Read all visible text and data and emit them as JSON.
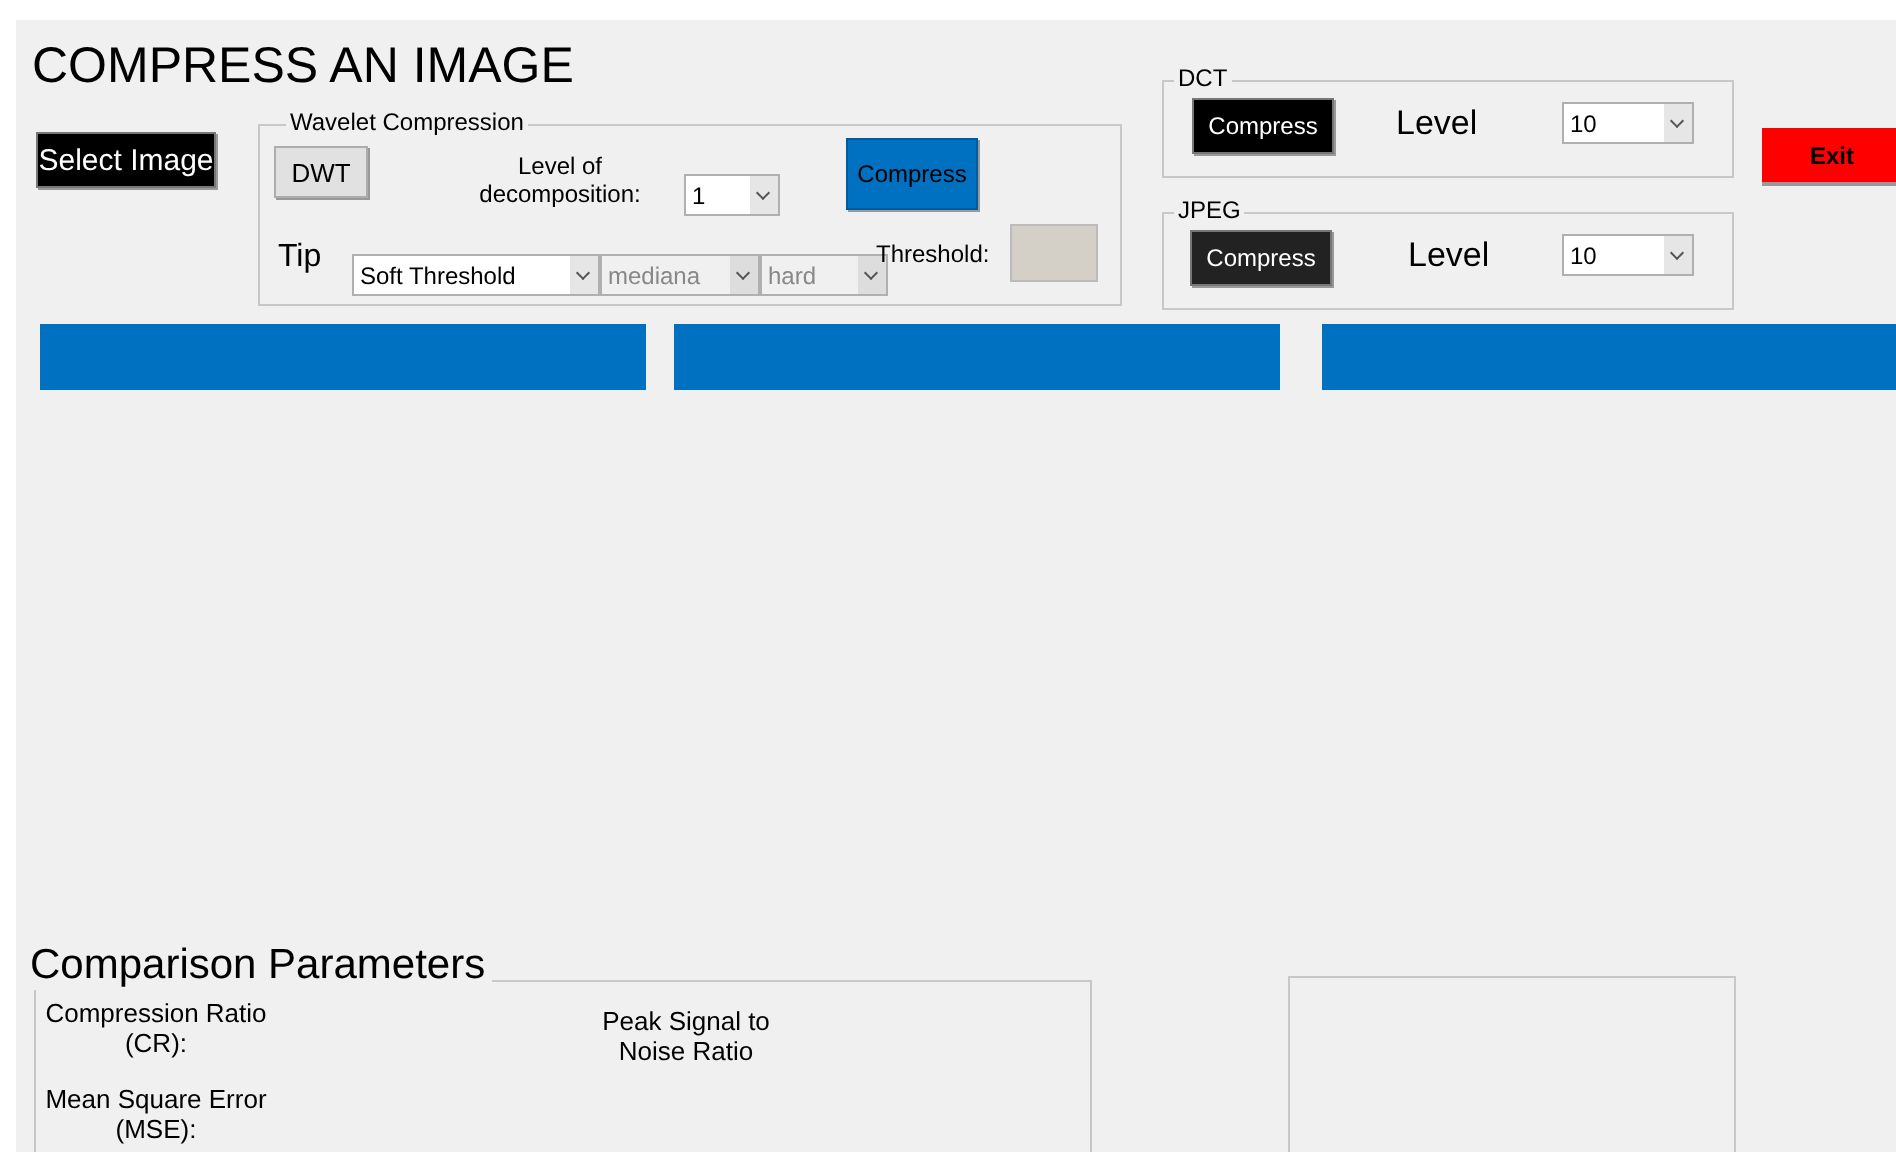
{
  "title": "COMPRESS AN IMAGE",
  "select_button": "Select Image",
  "wavelet": {
    "title": "Wavelet Compression",
    "dwt_button": "DWT",
    "level_label": "Level of decomposition:",
    "level_value": "1",
    "compress_button": "Compress",
    "tip_label": "Tip",
    "dropdowns": [
      {
        "value": "Soft Threshold",
        "disabled": false
      },
      {
        "value": "mediana",
        "disabled": true
      },
      {
        "value": "hard",
        "disabled": true
      }
    ],
    "threshold_label": "Threshold:",
    "threshold_disabled": true
  },
  "dct": {
    "title": "DCT",
    "compress_button": "Compress",
    "level_label": "Level",
    "level_value": "10"
  },
  "jpeg": {
    "title": "JPEG",
    "compress_button": "Compress",
    "level_label": "Level",
    "level_value": "10"
  },
  "exit_button": "Exit",
  "comparison": {
    "title": "Comparison Parameters",
    "labels": [
      "Compression Ratio (CR):",
      "Mean Square Error (MSE):"
    ],
    "psnr_label": "Peak Signal to Noise Ratio"
  }
}
